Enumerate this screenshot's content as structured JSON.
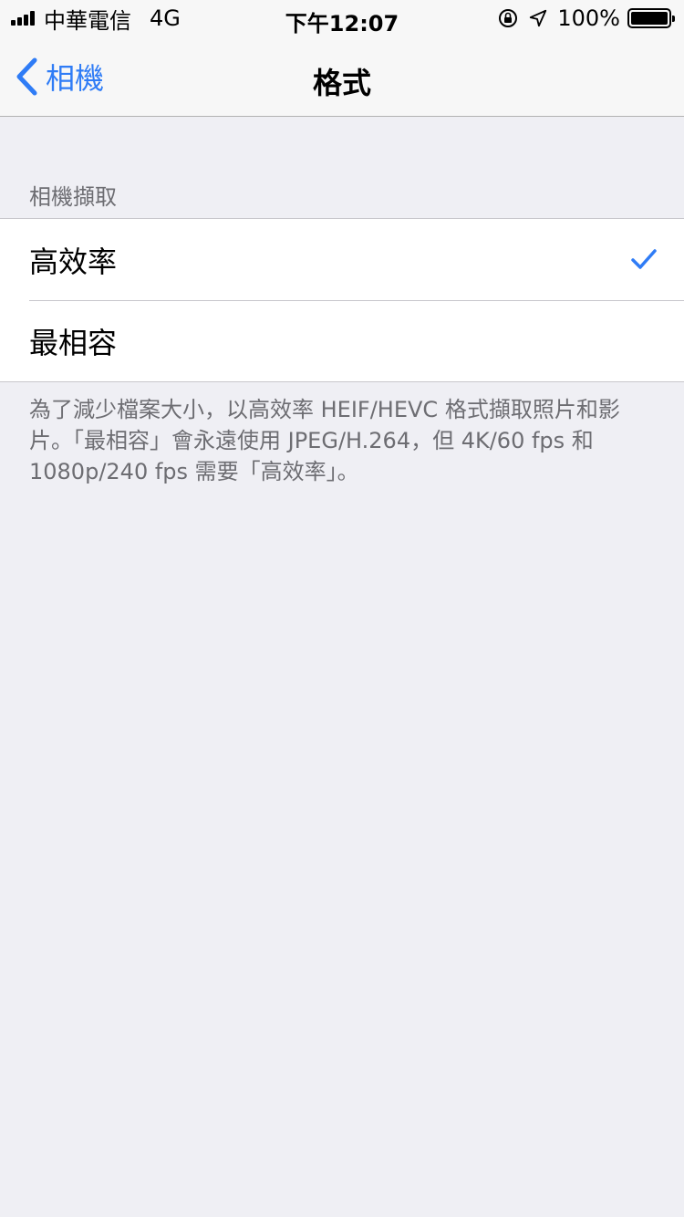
{
  "status_bar": {
    "carrier": "中華電信",
    "network": "4G",
    "time": "下午12:07",
    "battery": "100%"
  },
  "nav": {
    "back_label": "相機",
    "title": "格式"
  },
  "section": {
    "header": "相機擷取",
    "options": [
      {
        "label": "高效率",
        "selected": true
      },
      {
        "label": "最相容",
        "selected": false
      }
    ],
    "footer": "為了減少檔案大小，以高效率 HEIF/HEVC 格式擷取照片和影片。「最相容」會永遠使用 JPEG/H.264，但 4K/60 fps 和 1080p/240 fps 需要「高效率」。"
  },
  "colors": {
    "accent": "#2f7cf6",
    "background": "#efeff4",
    "secondary_text": "#6d6d72",
    "separator": "#c8c7cc"
  }
}
